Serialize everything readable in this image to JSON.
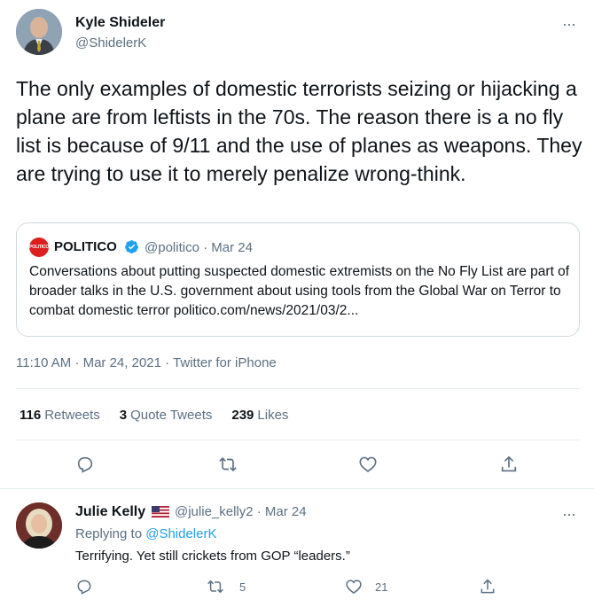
{
  "main_tweet": {
    "author_name": "Kyle Shideler",
    "author_handle": "@ShidelerK",
    "more_label": "···",
    "text": "The only examples of domestic terrorists seizing or hijacking a plane are from leftists in the 70s. The reason there is a no fly list is because of 9/11 and the use of planes as weapons. They are trying to use it to merely penalize wrong-think.",
    "quote": {
      "logo_text": "POLITICO",
      "author_name": "POLITICO",
      "meta": "@politico · Mar 24",
      "text": "Conversations about putting suspected domestic extremists on the No Fly List are part of broader talks in the U.S. government about using tools from the Global War on Terror to combat domestic terror politico.com/news/2021/03/2..."
    },
    "timestamp": "11:10 AM · Mar 24, 2021 · Twitter for iPhone",
    "stats": {
      "retweets_count": "116",
      "retweets_label": "Retweets",
      "quotes_count": "3",
      "quotes_label": "Quote Tweets",
      "likes_count": "239",
      "likes_label": "Likes"
    }
  },
  "reply_tweet": {
    "author_name": "Julie Kelly",
    "meta": "@julie_kelly2 · Mar 24",
    "replying_prefix": "Replying to",
    "replying_handle": "@ShidelerK",
    "text": "Terrifying. Yet still crickets from GOP “leaders.”",
    "retweet_count": "5",
    "like_count": "21",
    "more_label": "···"
  },
  "icons": {
    "reply": "reply-icon",
    "retweet": "retweet-icon",
    "like": "heart-icon",
    "share": "share-icon",
    "verified": "verified-badge-icon",
    "flag": "us-flag-icon"
  },
  "colors": {
    "text_primary": "#0f1419",
    "text_secondary": "#5b7083",
    "link": "#1da1f2",
    "border": "#e6ecf0",
    "politico_red": "#dc1e1e"
  }
}
